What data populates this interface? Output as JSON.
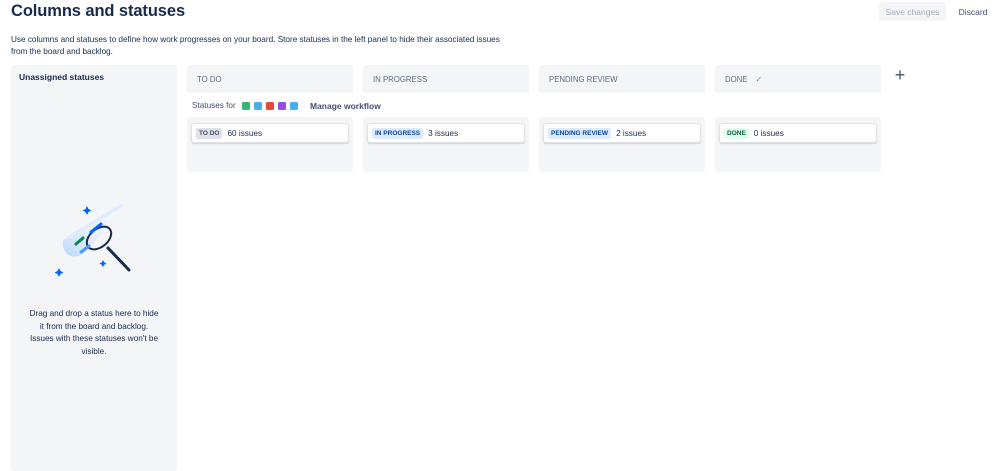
{
  "header": {
    "title": "Columns and statuses",
    "save_label": "Save changes",
    "discard_label": "Discard",
    "description": "Use columns and statuses to define how work progresses on your board. Store statuses in the left panel to hide their associated issues from the board and backlog."
  },
  "unassigned": {
    "title": "Unassigned statuses",
    "empty_message": "Drag and drop a status here to hide it from the board and backlog. Issues with these statuses won't be visible."
  },
  "statuses_for": {
    "label": "Statuses for",
    "issue_type_icons": [
      "story-icon",
      "task-icon",
      "bug-icon",
      "epic-icon",
      "subtask-icon"
    ],
    "issue_type_colors": [
      "#36b37e",
      "#4bade8",
      "#e5493a",
      "#904ee2",
      "#4bade8"
    ],
    "manage_label": "Manage workflow"
  },
  "columns": [
    {
      "header": "TO DO",
      "status": "TO DO",
      "count": "60 issues"
    },
    {
      "header": "IN PROGRESS",
      "status": "IN PROGRESS",
      "count": "3 issues"
    },
    {
      "header": "PENDING REVIEW",
      "status": "PENDING REVIEW",
      "count": "2 issues"
    },
    {
      "header": "DONE",
      "status": "DONE",
      "count": "0 issues",
      "header_icon": "check-icon"
    }
  ],
  "add_column_icon": "plus-icon"
}
